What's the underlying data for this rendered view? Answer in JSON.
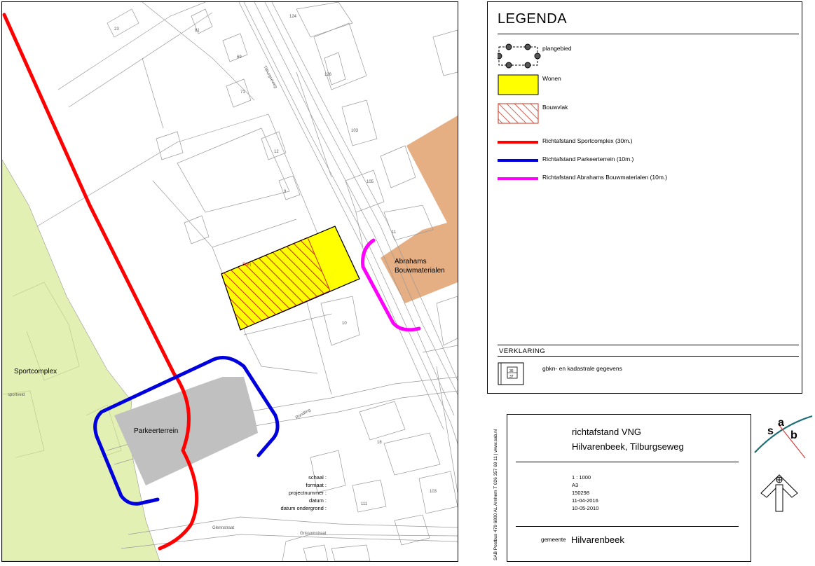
{
  "map": {
    "labels": {
      "sportcomplex": "Sportcomplex",
      "parkeerterrein": "Parkeerterrein",
      "abrahams_line1": "Abrahams",
      "abrahams_line2": "Bouwmaterialen",
      "streets": [
        "Tilburgseweg",
        "Rondling",
        "Glennstraat",
        "Grissomstraat"
      ],
      "house_numbers": [
        "23",
        "81",
        "124",
        "69",
        "126",
        "103",
        "71",
        "12",
        "9",
        "105",
        "11",
        "10",
        "18",
        "111",
        "103"
      ]
    },
    "colors": {
      "sportcomplex_fill": "#e3f0b4",
      "wonen_fill": "#ffff00",
      "bouwvlak_hatch": "#c8321e",
      "abrahams_fill": "#e5ae83",
      "parking_fill": "#c0c0c0",
      "red_line": "#ff0000",
      "blue_line": "#0000dd",
      "magenta_line": "#ff00ff"
    }
  },
  "legend": {
    "title": "LEGENDA",
    "items": [
      {
        "label": "plangebied",
        "symbol": "plangebied"
      },
      {
        "label": "Wonen",
        "symbol": "wonen"
      },
      {
        "label": "Bouwvlak",
        "symbol": "bouwvlak"
      },
      {
        "label": "Richtafstand Sportcomplex (30m.)",
        "symbol": "line-red"
      },
      {
        "label": "Richtafstand Parkeerterrein (10m.)",
        "symbol": "line-blue"
      },
      {
        "label": "Richtafstand Abrahams Bouwmaterialen (10m.)",
        "symbol": "line-magenta"
      }
    ],
    "verklaring_title": "VERKLARING",
    "verklaring_item": "gbkn- en kadastrale gegevens"
  },
  "title_block": {
    "title_line1": "richtafstand VNG",
    "title_line2": "Hilvarenbeek, Tilburgseweg",
    "meta": [
      {
        "key": "schaal :",
        "value": "1 : 1000"
      },
      {
        "key": "formaat :",
        "value": "A3"
      },
      {
        "key": "projectnummer :",
        "value": "150298"
      },
      {
        "key": "datum :",
        "value": "11-04-2016"
      },
      {
        "key": "datum ondergrond :",
        "value": "10-05-2010"
      }
    ],
    "gemeente_key": "gemeente",
    "gemeente_value": "Hilvarenbeek",
    "side_text": "SAB Postbus 479  6800 AL Arnhem  T 026 357 69 11  |  www.sab.nl"
  },
  "logo": {
    "letters": [
      "s",
      "a",
      "b"
    ]
  },
  "north_arrow": {
    "icon": "north-arrow-icon"
  }
}
